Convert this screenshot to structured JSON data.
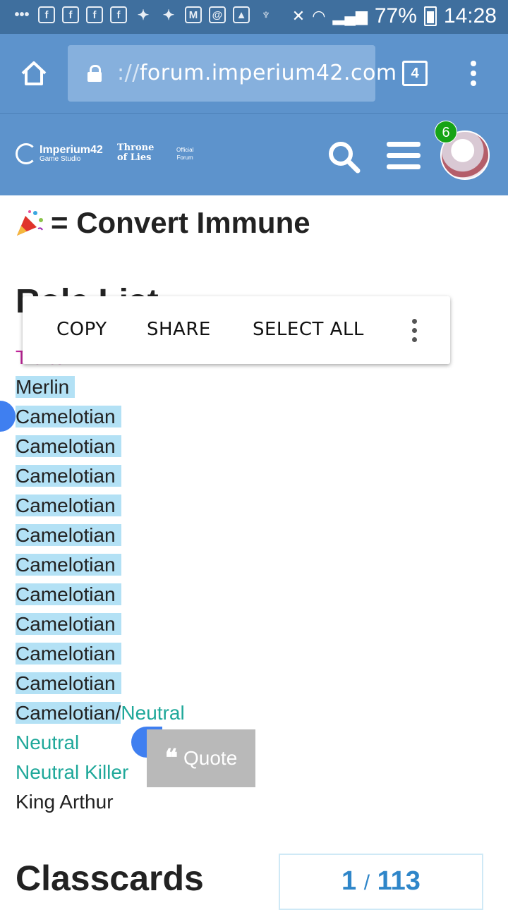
{
  "status_bar": {
    "battery": "77%",
    "time": "14:28"
  },
  "browser": {
    "url_dim": "://",
    "url_domain": "forum.imperium42.com",
    "tab_count": "4"
  },
  "site": {
    "brand_name": "Imperium42",
    "brand_sub": "Game Studio",
    "tol_line1": "Throne",
    "tol_line2": "of Lies",
    "official_line1": "Official",
    "official_line2": "Forum",
    "notification_count": "6"
  },
  "post": {
    "convert_text": "= Convert Immune",
    "role_list_heading": "Role List",
    "roles": [
      {
        "text": "Traitor",
        "color": "#c0259a"
      },
      {
        "text": "Merlin"
      },
      {
        "text": "Camelotian"
      },
      {
        "text": "Camelotian"
      },
      {
        "text": "Camelotian"
      },
      {
        "text": "Camelotian"
      },
      {
        "text": "Camelotian"
      },
      {
        "text": "Camelotian"
      },
      {
        "text": "Camelotian"
      },
      {
        "text": "Camelotian"
      },
      {
        "text": "Camelotian"
      },
      {
        "text": "Camelotian"
      },
      {
        "text": "Camelotian/",
        "extra": "Neutral"
      },
      {
        "text": "Neutral",
        "color": "#1fa89a"
      },
      {
        "text": "Neutral Killer",
        "color": "#1fa89a"
      },
      {
        "text": "King Arthur"
      }
    ],
    "classcards_heading": "Classcards"
  },
  "context_menu": {
    "copy": "COPY",
    "share": "SHARE",
    "select_all": "SELECT ALL"
  },
  "quote_button": {
    "label": "Quote"
  },
  "pager": {
    "current": "1",
    "separator": "/",
    "total": "113"
  },
  "colors": {
    "header": "#5d93cc",
    "status": "#3f6f9e",
    "selection": "#b3e1f5",
    "handle": "#3f7ff0",
    "link_teal": "#1fa89a",
    "traitor": "#c0259a"
  }
}
